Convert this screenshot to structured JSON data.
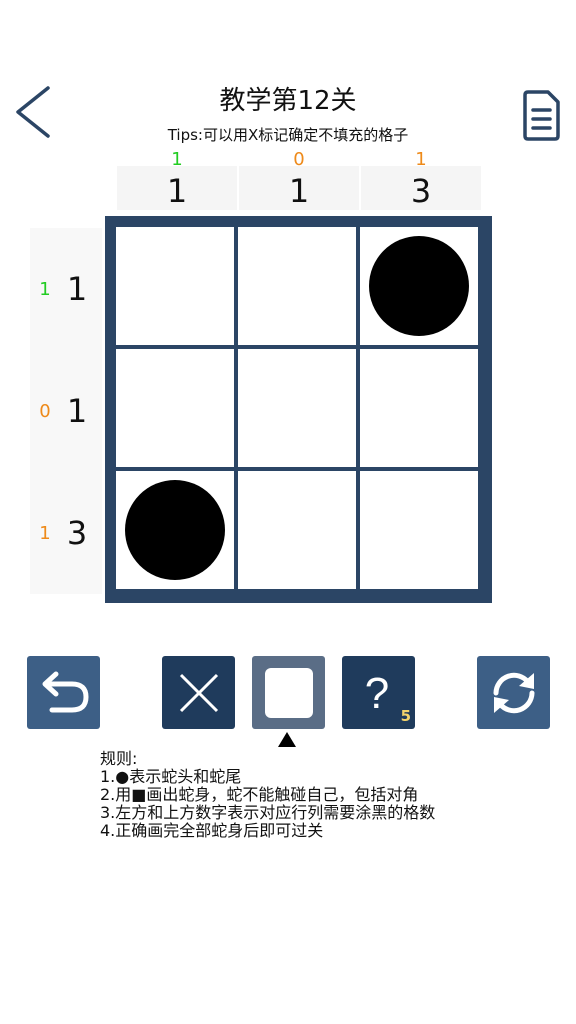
{
  "header": {
    "title": "教学第12关",
    "tips": "Tips:可以用X标记确定不填充的格子"
  },
  "column_hints": [
    {
      "count": "1",
      "count_color": "#22cc22",
      "target": "1"
    },
    {
      "count": "0",
      "count_color": "#ee8a1a",
      "target": "1"
    },
    {
      "count": "1",
      "count_color": "#ee8a1a",
      "target": "3"
    }
  ],
  "row_hints": [
    {
      "count": "1",
      "count_color": "#22cc22",
      "target": "1"
    },
    {
      "count": "0",
      "count_color": "#ee8a1a",
      "target": "1"
    },
    {
      "count": "1",
      "count_color": "#ee8a1a",
      "target": "3"
    }
  ],
  "grid": [
    [
      "empty",
      "empty",
      "dot"
    ],
    [
      "empty",
      "empty",
      "empty"
    ],
    [
      "dot",
      "empty",
      "empty"
    ]
  ],
  "toolbar": {
    "undo_icon": "undo-icon",
    "cross_icon": "cross-icon",
    "fill_icon": "square-icon",
    "hint_icon": "question-icon",
    "hint_count": "5",
    "reset_icon": "refresh-icon",
    "selected_tool": "fill"
  },
  "rules": {
    "heading": "规则:",
    "lines": [
      "1.●表示蛇头和蛇尾",
      "2.用■画出蛇身，蛇不能触碰自己，包括对角",
      "3.左方和上方数字表示对应行列需要涂黑的格数",
      "4.正确画完全部蛇身后即可过关"
    ]
  },
  "colors": {
    "board": "#2b4565",
    "button_dark": "#1f3b5c",
    "button_mid": "#3d5f86",
    "accent_green": "#22cc22",
    "accent_orange": "#ee8a1a",
    "hint_count": "#f3d36b"
  }
}
